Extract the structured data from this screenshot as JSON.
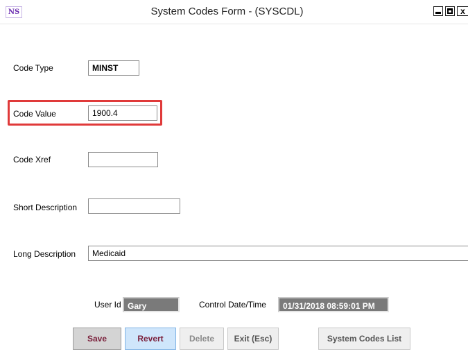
{
  "window": {
    "icon_text": "NS",
    "title": "System Codes Form - (SYSCDL)",
    "close_glyph": "x"
  },
  "form": {
    "code_type": {
      "label": "Code Type",
      "value": "MINST"
    },
    "code_value": {
      "label": "Code Value",
      "value": "1900.4"
    },
    "code_xref": {
      "label": "Code Xref",
      "value": ""
    },
    "short_description": {
      "label": "Short Description",
      "value": ""
    },
    "long_description": {
      "label": "Long Description",
      "value": "Medicaid"
    },
    "user_id": {
      "label": "User Id",
      "value": "Gary"
    },
    "control_datetime": {
      "label": "Control Date/Time",
      "value": "01/31/2018 08:59:01 PM"
    }
  },
  "buttons": {
    "save": "Save",
    "revert": "Revert",
    "delete": "Delete",
    "exit": "Exit (Esc)",
    "system_codes_list": "System Codes List"
  },
  "colors": {
    "highlight": "#e03a3a",
    "button_text": "#7a1f3a",
    "revert_bg": "#cfe6fb",
    "readonly_bg": "#7a7a7a"
  }
}
